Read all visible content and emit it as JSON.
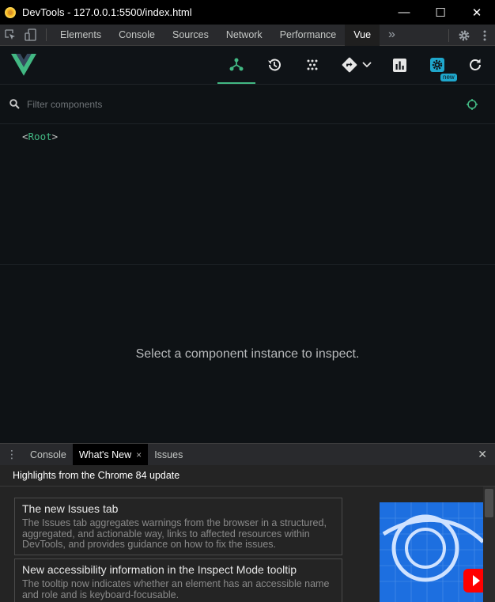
{
  "window": {
    "title": "DevTools - 127.0.0.1:5500/index.html",
    "minimize": "—",
    "maximize": "☐",
    "close": "✕"
  },
  "devtools": {
    "tabs": [
      "Elements",
      "Console",
      "Sources",
      "Network",
      "Performance",
      "Vue"
    ],
    "active_tab": "Vue",
    "more": "»"
  },
  "vue_toolbar": {
    "new_badge": "new"
  },
  "filter": {
    "placeholder": "Filter components"
  },
  "tree": {
    "open": "<",
    "root": "Root",
    "close": ">"
  },
  "inspector": {
    "empty_message": "Select a component instance to inspect."
  },
  "drawer": {
    "tabs": [
      "Console",
      "What's New",
      "Issues"
    ],
    "active_tab": "What's New",
    "tab_close": "×",
    "header": "Highlights from the Chrome 84 update",
    "cards": [
      {
        "title": "The new Issues tab",
        "desc": "The Issues tab aggregates warnings from the browser in a structured, aggregated, and actionable way, links to affected resources within DevTools, and provides guidance on how to fix the issues."
      },
      {
        "title": "New accessibility information in the Inspect Mode tooltip",
        "desc": "The tooltip now indicates whether an element has an accessible name and role and is keyboard-focusable."
      }
    ]
  },
  "colors": {
    "vue_green": "#42b883",
    "accent_blue": "#1fa7cc",
    "panel_bg": "#0e1215"
  }
}
